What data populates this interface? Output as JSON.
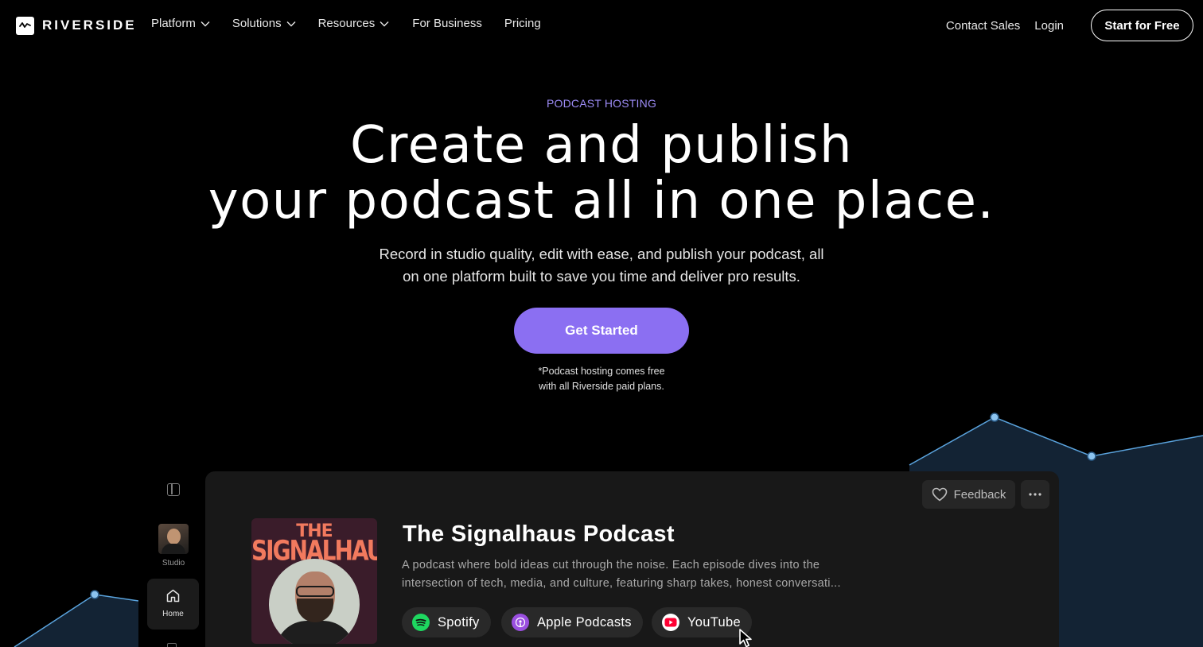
{
  "nav": {
    "brand": "RIVERSIDE",
    "links": [
      {
        "label": "Platform",
        "dropdown": true
      },
      {
        "label": "Solutions",
        "dropdown": true
      },
      {
        "label": "Resources",
        "dropdown": true
      },
      {
        "label": "For Business",
        "dropdown": false
      },
      {
        "label": "Pricing",
        "dropdown": false
      }
    ],
    "contact_sales": "Contact Sales",
    "login": "Login",
    "start_free": "Start for Free"
  },
  "hero": {
    "eyebrow": "PODCAST HOSTING",
    "headline_line1": "Create and publish",
    "headline_line2": "your podcast all in one place.",
    "sub_line1": "Record in studio quality, edit with ease, and publish your podcast, all",
    "sub_line2": "on one platform built to save you time and deliver pro results.",
    "cta": "Get Started",
    "note_line1": "*Podcast hosting comes free",
    "note_line2": "with all Riverside paid plans."
  },
  "sidebar": {
    "studio_label": "Studio",
    "home_label": "Home"
  },
  "app": {
    "feedback_label": "Feedback",
    "cover_title_line1": "THE",
    "cover_title_line2": "SIGNALHAUS",
    "podcast_title": "The Signalhaus Podcast",
    "description_line1": "A podcast where bold ideas cut through the noise. Each episode dives into the",
    "description_line2": "intersection of tech, media, and culture, featuring sharp takes, honest conversati...",
    "platforms": [
      {
        "label": "Spotify",
        "icon": "spotify-icon",
        "color": "#1ed760"
      },
      {
        "label": "Apple Podcasts",
        "icon": "apple-podcasts-icon",
        "color": "#9a4fe0"
      },
      {
        "label": "YouTube",
        "icon": "youtube-icon",
        "color": "#ff0033"
      }
    ]
  },
  "colors": {
    "accent": "#8b6ff2",
    "eyebrow": "#9d8cf7",
    "chart_line": "#4f9ad6"
  }
}
